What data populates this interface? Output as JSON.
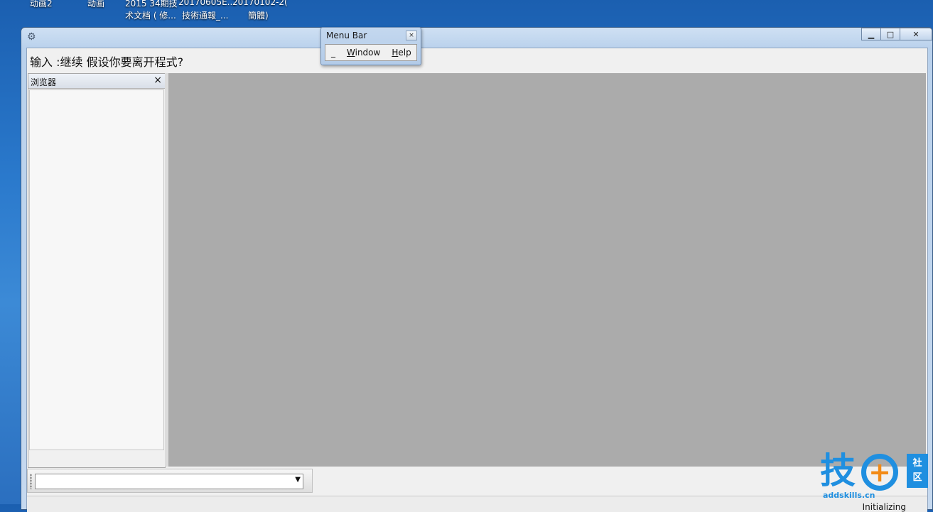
{
  "desktop": {
    "row1": [
      "动画2",
      "动画",
      "2015 34期技",
      "20170605E...",
      "20170102-2("
    ],
    "row2": [
      "术文档 ( 修...",
      "技術通報_...",
      "簡體)"
    ]
  },
  "main_window": {
    "prompt": "输入 :继续 假设你要离开程式?",
    "browser_panel": {
      "title": "浏览器",
      "close": "×"
    },
    "status": "Initializing"
  },
  "menu_bar_window": {
    "title": "Menu Bar",
    "close": "×",
    "items": [
      {
        "label": "_",
        "accel": ""
      },
      {
        "accel": "W",
        "rest": "indow"
      },
      {
        "accel": "H",
        "rest": "elp"
      }
    ]
  },
  "watermark": {
    "main": "技",
    "plus": "+",
    "side_top": "社",
    "side_bottom": "区",
    "url": "addskills.cn"
  },
  "colors": {
    "accent": "#1f8fe0",
    "plus": "#f28a16",
    "mdi_background": "#ababab"
  }
}
